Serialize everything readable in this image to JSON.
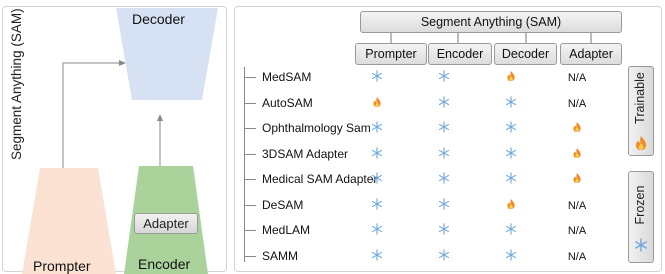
{
  "left": {
    "vertical_title": "Segment Anything (SAM)",
    "decoder": "Decoder",
    "prompter": "Prompter",
    "encoder": "Encoder",
    "adapter": "Adapter"
  },
  "table": {
    "header": "Segment Anything (SAM)",
    "columns": [
      "Prompter",
      "Encoder",
      "Decoder",
      "Adapter"
    ],
    "na_text": "N/A",
    "rows": [
      {
        "name": "MedSAM",
        "cells": [
          "frozen",
          "frozen",
          "trainable",
          "N/A"
        ]
      },
      {
        "name": "AutoSAM",
        "cells": [
          "trainable",
          "frozen",
          "frozen",
          "N/A"
        ]
      },
      {
        "name": "Ophthalmology Sam",
        "cells": [
          "frozen",
          "frozen",
          "frozen",
          "trainable"
        ]
      },
      {
        "name": "3DSAM Adapter",
        "cells": [
          "frozen",
          "frozen",
          "frozen",
          "trainable"
        ]
      },
      {
        "name": "Medical SAM Adapter",
        "cells": [
          "frozen",
          "frozen",
          "frozen",
          "trainable"
        ]
      },
      {
        "name": "DeSAM",
        "cells": [
          "frozen",
          "frozen",
          "trainable",
          "N/A"
        ]
      },
      {
        "name": "MedLAM",
        "cells": [
          "frozen",
          "frozen",
          "frozen",
          "N/A"
        ]
      },
      {
        "name": "SAMM",
        "cells": [
          "frozen",
          "frozen",
          "frozen",
          "N/A"
        ]
      }
    ]
  },
  "legend": {
    "trainable": "Trainable",
    "frozen": "Frozen"
  },
  "colors": {
    "decoder": "#d6e1f3",
    "prompter": "#fbe2d3",
    "encoder": "#a9d39b",
    "flame": "#f08a24",
    "snowflake": "#6fa8dc"
  },
  "icons": {
    "trainable": "fire-icon",
    "frozen": "snowflake-icon"
  }
}
